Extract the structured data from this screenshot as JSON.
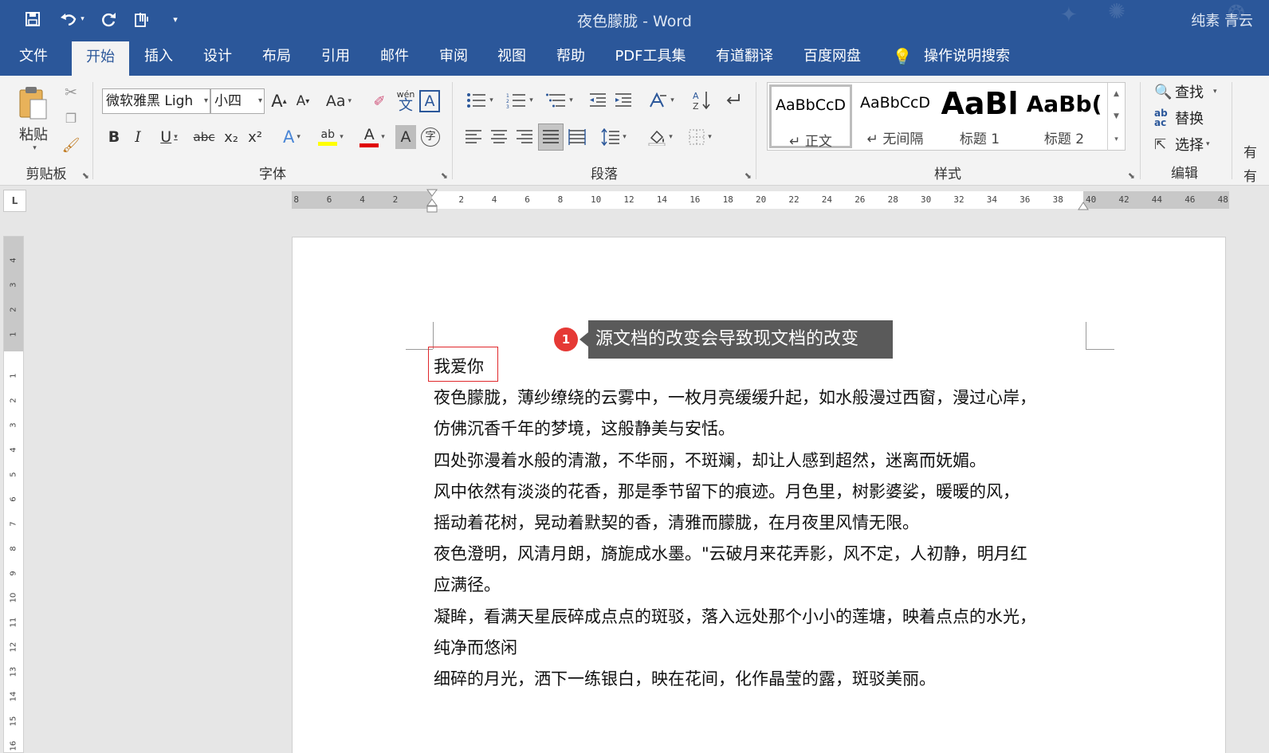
{
  "window": {
    "title": "夜色朦胧  -  Word",
    "user": "纯素 青云"
  },
  "quick_access": {
    "icons": [
      "save-icon",
      "undo-icon",
      "redo-icon",
      "touch-mode-icon",
      "customize-icon"
    ]
  },
  "tabs": [
    {
      "label": "文件"
    },
    {
      "label": "开始",
      "active": true
    },
    {
      "label": "插入"
    },
    {
      "label": "设计"
    },
    {
      "label": "布局"
    },
    {
      "label": "引用"
    },
    {
      "label": "邮件"
    },
    {
      "label": "审阅"
    },
    {
      "label": "视图"
    },
    {
      "label": "帮助"
    },
    {
      "label": "PDF工具集"
    },
    {
      "label": "有道翻译"
    },
    {
      "label": "百度网盘"
    },
    {
      "label": "操作说明搜索"
    }
  ],
  "ribbon": {
    "clipboard": {
      "label": "剪贴板",
      "paste_label": "粘贴"
    },
    "font": {
      "label": "字体",
      "font_name": "微软雅黑 Ligh",
      "font_size": "小四",
      "change_case": "Aa",
      "phonetic": "wén",
      "phonetic_char": "文",
      "char_border": "A",
      "bold": "B",
      "italic": "I",
      "underline": "U",
      "strike": "abc",
      "subscript": "x₂",
      "superscript": "x²",
      "text_effects": "A",
      "highlight": "ab",
      "font_color": "A",
      "char_shading": "A",
      "enclose": "字",
      "highlight_color": "#ffff00",
      "font_color_value": "#e00000"
    },
    "paragraph": {
      "label": "段落"
    },
    "styles": {
      "label": "样式",
      "items": [
        {
          "preview": "AaBbCcD",
          "name": "↵ 正文"
        },
        {
          "preview": "AaBbCcD",
          "name": "↵ 无间隔"
        },
        {
          "preview": "AaBl",
          "name": "标题 1"
        },
        {
          "preview": "AaBb(",
          "name": "标题 2"
        }
      ]
    },
    "editing": {
      "label": "编辑",
      "find": "查找",
      "replace": "替换",
      "select": "选择"
    },
    "overflow_chars": [
      "有",
      "有"
    ]
  },
  "ruler": {
    "tab_selector": "L",
    "h_numbers": [
      "8",
      "6",
      "4",
      "2",
      "2",
      "4",
      "6",
      "8",
      "10",
      "12",
      "14",
      "16",
      "18",
      "20",
      "22",
      "24",
      "26",
      "28",
      "30",
      "32",
      "34",
      "36",
      "38",
      "40",
      "42",
      "44",
      "46",
      "48"
    ],
    "v_numbers": [
      "4",
      "3",
      "2",
      "1",
      "1",
      "2",
      "3",
      "4",
      "5",
      "6",
      "7",
      "8",
      "9",
      "10",
      "11",
      "12",
      "13",
      "14",
      "15",
      "16"
    ]
  },
  "callout": {
    "badge": "1",
    "text": "源文档的改变会导致现文档的改变"
  },
  "document": {
    "heading": "我爱你",
    "paragraphs": [
      "夜色朦胧，薄纱缭绕的云雾中，一枚月亮缓缓升起，如水般漫过西窗，漫过心岸，",
      "仿佛沉香千年的梦境，这般静美与安恬。",
      "四处弥漫着水般的清澈，不华丽，不斑斓，却让人感到超然，迷离而妩媚。",
      "风中依然有淡淡的花香，那是季节留下的痕迹。月色里，树影婆娑，暖暖的风，",
      "摇动着花树，晃动着默契的香，清雅而朦胧，在月夜里风情无限。",
      "夜色澄明，风清月朗，旖旎成水墨。\"云破月来花弄影，风不定，人初静，明月红",
      "应满径。",
      "凝眸，看满天星辰碎成点点的斑驳，落入远处那个小小的莲塘，映着点点的水光，",
      "纯净而悠闲",
      "细碎的月光，洒下一练银白，映在花间，化作晶莹的露，斑驳美丽。"
    ]
  },
  "colors": {
    "title_bar": "#2b579a",
    "ribbon": "#f3f3f3",
    "callout": "#5a5a5a",
    "badge": "#e53935",
    "heading_box": "#e0282b"
  }
}
